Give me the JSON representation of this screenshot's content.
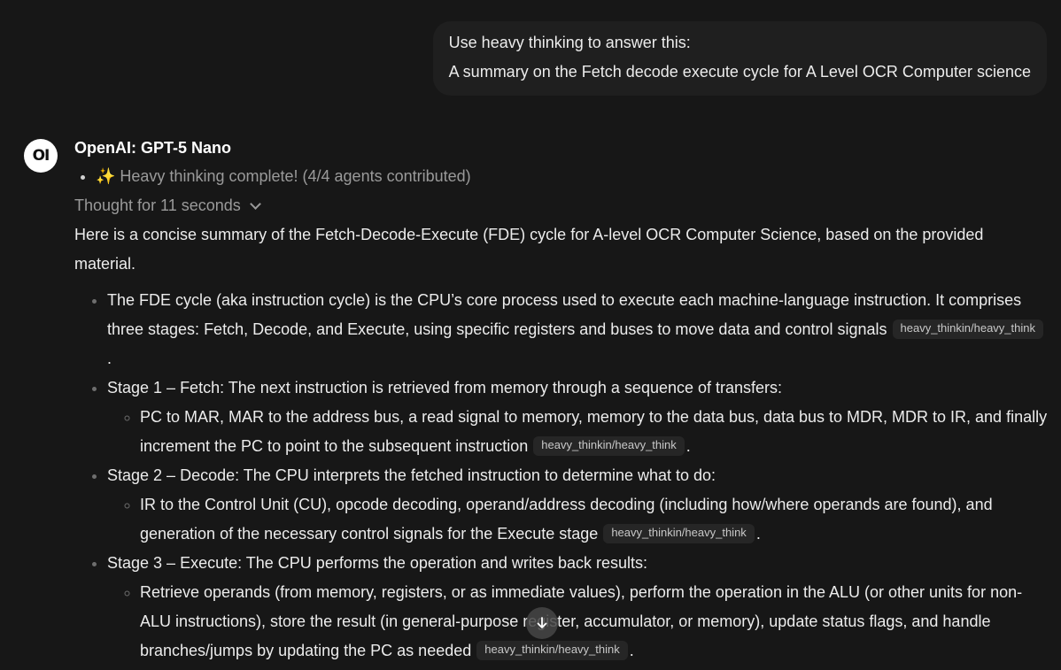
{
  "user_message": {
    "lines": [
      "Use heavy thinking to answer this:",
      "A summary on the Fetch decode execute cycle for A Level OCR Computer science"
    ]
  },
  "assistant": {
    "avatar_text": "OI",
    "model_name": "OpenAI: GPT-5 Nano",
    "status": "✨ Heavy thinking complete! (4/4 agents contributed)",
    "thought_label": "Thought for 11 seconds",
    "intro": "Here is a concise summary of the Fetch-Decode-Execute (FDE) cycle for A-level OCR Computer Science, based on the provided material.",
    "bullets": [
      {
        "text": "The FDE cycle (aka instruction cycle) is the CPU’s core process used to execute each machine-language instruction. It comprises three stages: Fetch, Decode, and Execute, using specific registers and buses to move data and control signals",
        "citation": "heavy_thinkin/heavy_think"
      },
      {
        "text": "Stage 1 – Fetch: The next instruction is retrieved from memory through a sequence of transfers:",
        "sub": {
          "text": "PC to MAR, MAR to the address bus, a read signal to memory, memory to the data bus, data bus to MDR, MDR to IR, and finally increment the PC to point to the subsequent instruction",
          "citation": "heavy_thinkin/heavy_think"
        }
      },
      {
        "text": "Stage 2 – Decode: The CPU interprets the fetched instruction to determine what to do:",
        "sub": {
          "text": "IR to the Control Unit (CU), opcode decoding, operand/address decoding (including how/where operands are found), and generation of the necessary control signals for the Execute stage",
          "citation": "heavy_thinkin/heavy_think"
        }
      },
      {
        "text": "Stage 3 – Execute: The CPU performs the operation and writes back results:",
        "sub": {
          "text": "Retrieve operands (from memory, registers, or as immediate values), perform the operation in the ALU (or other units for non-ALU instructions), store the result (in general-purpose register, accumulator, or memory), update status flags, and handle branches/jumps by updating the PC as needed",
          "citation": "heavy_thinkin/heavy_think"
        }
      }
    ],
    "period": "."
  },
  "icons": {
    "scroll": "arrow-down-icon",
    "expand": "chevron-down-icon"
  },
  "colors": {
    "background": "#171717",
    "user_bubble": "#1f1f1f",
    "citation_bg": "#262626"
  }
}
